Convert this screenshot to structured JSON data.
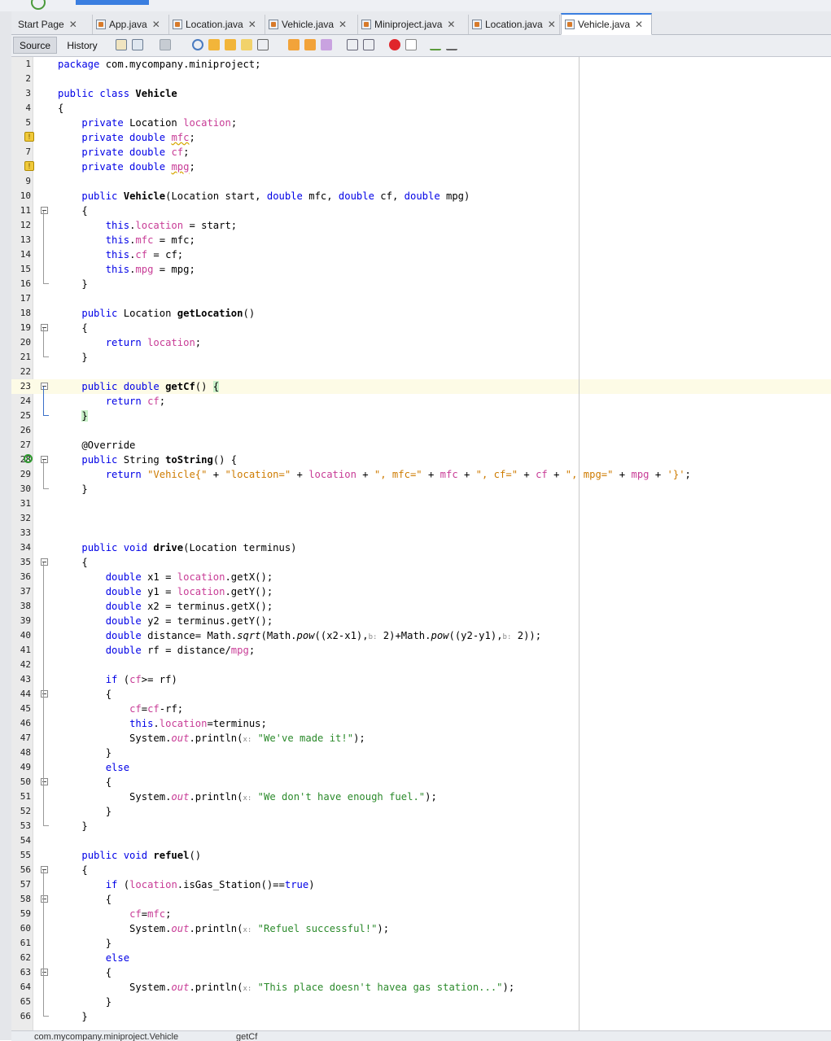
{
  "tabs": [
    {
      "label": "Start Page",
      "icon": false,
      "active": false
    },
    {
      "label": "App.java",
      "icon": true,
      "active": false
    },
    {
      "label": "Location.java",
      "icon": true,
      "active": false
    },
    {
      "label": "Vehicle.java",
      "icon": true,
      "active": false
    },
    {
      "label": "Miniproject.java",
      "icon": true,
      "active": false
    },
    {
      "label": "Location.java",
      "icon": true,
      "active": false
    },
    {
      "label": "Vehicle.java",
      "icon": true,
      "active": true
    }
  ],
  "toolbar": {
    "source_label": "Source",
    "history_label": "History"
  },
  "breadcrumb": {
    "path": "com.mycompany.miniproject.Vehicle",
    "method": "getCf"
  },
  "code": {
    "highlighted_line": 23,
    "warning_lines": [
      6,
      8
    ],
    "override_line": 28,
    "fold_lines": [
      11,
      19,
      23,
      28,
      35,
      44,
      50,
      56,
      58,
      63
    ],
    "lines": [
      "1",
      "2",
      "3",
      "4",
      "5",
      "6",
      "7",
      "8",
      "9",
      "10",
      "11",
      "12",
      "13",
      "14",
      "15",
      "16",
      "17",
      "18",
      "19",
      "20",
      "21",
      "22",
      "23",
      "24",
      "25",
      "26",
      "27",
      "28",
      "29",
      "30",
      "31",
      "32",
      "33",
      "34",
      "35",
      "36",
      "37",
      "38",
      "39",
      "40",
      "41",
      "42",
      "43",
      "44",
      "45",
      "46",
      "47",
      "48",
      "49",
      "50",
      "51",
      "52",
      "53",
      "54",
      "55",
      "56",
      "57",
      "58",
      "59",
      "60",
      "61",
      "62",
      "63",
      "64",
      "65",
      "66"
    ]
  }
}
